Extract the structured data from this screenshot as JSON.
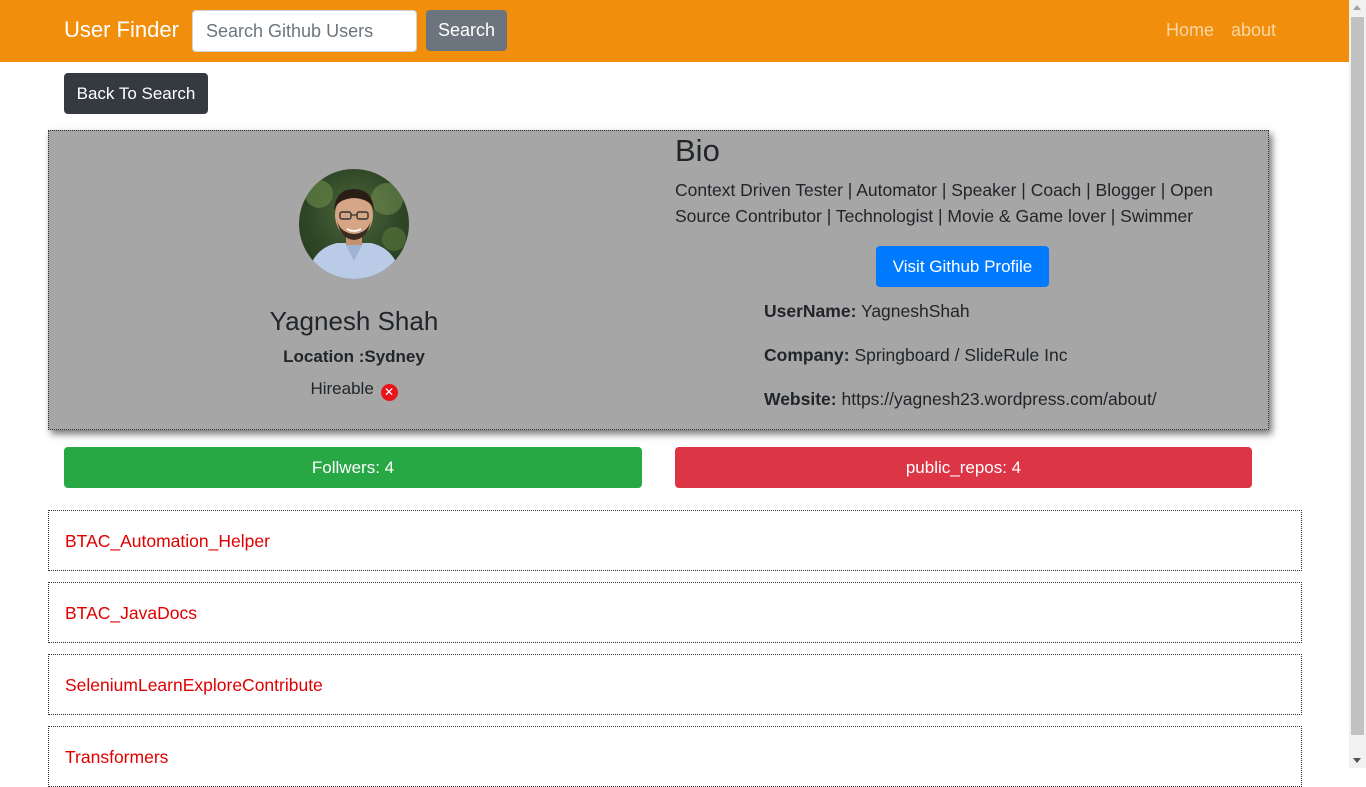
{
  "navbar": {
    "brand": "User Finder",
    "search_placeholder": "Search Github Users",
    "search_button": "Search",
    "links": [
      "Home",
      "about"
    ]
  },
  "back_button": "Back To Search",
  "profile": {
    "name": "Yagnesh Shah",
    "location": "Location :Sydney",
    "hireable_label": "Hireable",
    "hireable_icon": "x-circle-icon",
    "bio_heading": "Bio",
    "bio_text": "Context Driven Tester | Automator | Speaker | Coach | Blogger | Open Source Contributor | Technologist | Movie & Game lover | Swimmer",
    "visit_button": "Visit Github Profile",
    "username_label": "UserName:",
    "username": "YagneshShah",
    "company_label": "Company:",
    "company": "Springboard / SlideRule Inc",
    "website_label": "Website:",
    "website": "https://yagnesh23.wordpress.com/about/"
  },
  "stats": {
    "followers": "Follwers: 4",
    "public_repos": "public_repos: 4"
  },
  "repos": [
    "BTAC_Automation_Helper",
    "BTAC_JavaDocs",
    "SeleniumLearnExploreContribute",
    "Transformers"
  ],
  "colors": {
    "navbar": "#f18f0c",
    "card": "#a6a6a6",
    "primary": "#007bff",
    "success": "#28a745",
    "danger": "#dc3545",
    "repo_link": "#e00000"
  }
}
